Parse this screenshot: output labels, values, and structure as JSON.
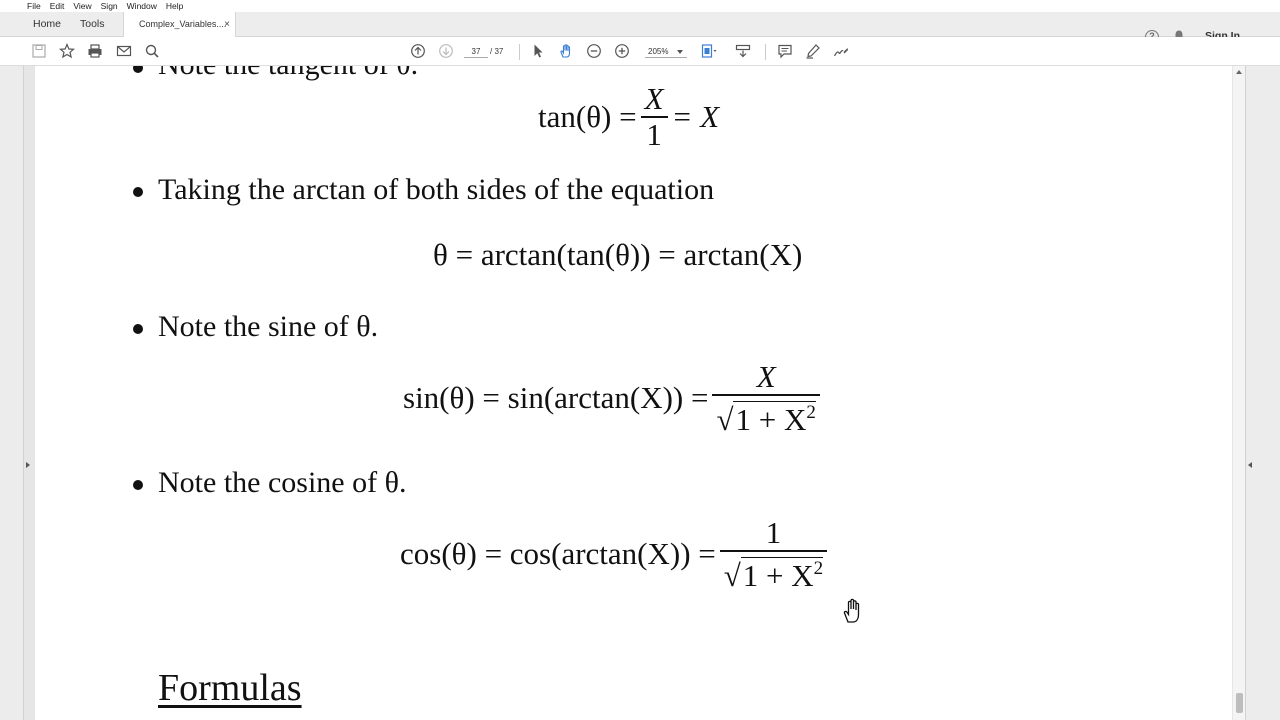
{
  "menu": [
    "File",
    "Edit",
    "View",
    "Sign",
    "Window",
    "Help"
  ],
  "tabs": {
    "home": "Home",
    "tools": "Tools",
    "document": "Complex_Variables....",
    "close": "×"
  },
  "header": {
    "sign_in": "Sign In",
    "help": "?"
  },
  "toolbar": {
    "page_current": "37",
    "page_total": "/ 37",
    "zoom": "205%",
    "icons": [
      "save-icon",
      "star-icon",
      "print-icon",
      "mail-icon",
      "search-icon",
      "prev-page-icon",
      "next-page-icon",
      "select-cursor-icon",
      "hand-tool-icon",
      "zoom-out-icon",
      "zoom-in-icon",
      "fit-page-icon",
      "scroll-mode-icon",
      "comment-icon",
      "highlight-icon",
      "sign-icon"
    ]
  },
  "document": {
    "partial_top_line": "Note the tangent of θ.",
    "eq_tan": {
      "lhs": "tan(θ) =",
      "num": "X",
      "den": "1",
      "rhs": "= X"
    },
    "bullet1": "Taking the arctan of both sides of the equation",
    "eq_theta": "θ = arctan(tan(θ)) = arctan(X)",
    "bullet2": "Note the sine of θ.",
    "eq_sin": {
      "lhs": "sin(θ) = sin(arctan(X)) =",
      "num": "X",
      "den_radicand": "1 + X",
      "den_exp": "2"
    },
    "bullet3": "Note the cosine of θ.",
    "eq_cos": {
      "lhs": "cos(θ) = cos(arctan(X)) =",
      "num": "1",
      "den_radicand": "1 + X",
      "den_exp": "2"
    },
    "section_heading": "Formulas"
  }
}
